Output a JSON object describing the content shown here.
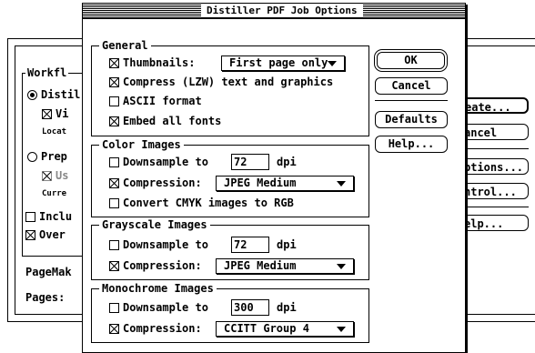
{
  "dialog": {
    "title": "Distiller PDF Job Options"
  },
  "general": {
    "label": "General",
    "thumbnails_label": "Thumbnails:",
    "thumbnails_value": "First page only",
    "compress_label": "Compress (LZW) text and graphics",
    "ascii_label": "ASCII format",
    "embed_label": "Embed all fonts"
  },
  "buttons": {
    "ok": "OK",
    "cancel": "Cancel",
    "defaults": "Defaults",
    "help": "Help..."
  },
  "color": {
    "label": "Color Images",
    "downsample_label": "Downsample to",
    "dpi_value": "72",
    "dpi_unit": "dpi",
    "compression_label": "Compression:",
    "compression_value": "JPEG Medium",
    "convert_label": "Convert CMYK images to RGB"
  },
  "grayscale": {
    "label": "Grayscale Images",
    "downsample_label": "Downsample to",
    "dpi_value": "72",
    "dpi_unit": "dpi",
    "compression_label": "Compression:",
    "compression_value": "JPEG Medium"
  },
  "mono": {
    "label": "Monochrome Images",
    "downsample_label": "Downsample to",
    "dpi_value": "300",
    "dpi_unit": "dpi",
    "compression_label": "Compression:",
    "compression_value": "CCITT Group 4"
  },
  "background": {
    "workflow_label": "Workfl",
    "distil_label": "Distil",
    "vi_label": "Vi",
    "locat_label": "Locat",
    "prep_label": "Prep",
    "us_label": "Us",
    "curre_label": "Curre",
    "inclu_label": "Inclu",
    "over_label": "Over",
    "pagemak_label": "PageMak",
    "pages_label": "Pages:",
    "create_btn": "eate...",
    "cancel_btn": "ancel",
    "options_btn": "ptions...",
    "control_btn": "ntrol...",
    "help_btn": "elp..."
  }
}
